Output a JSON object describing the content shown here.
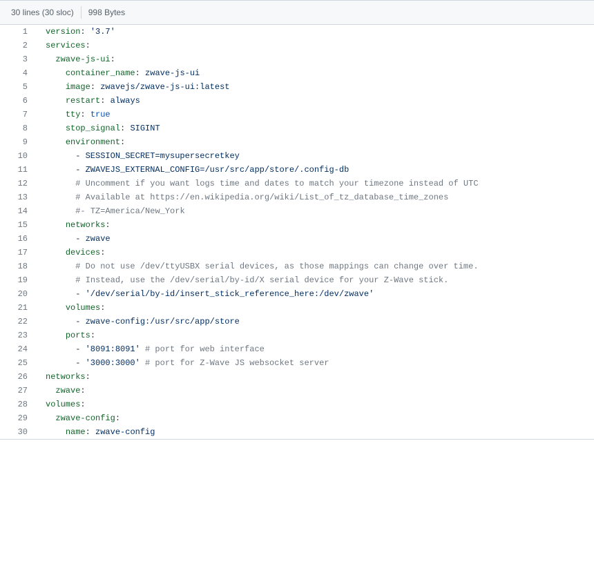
{
  "header": {
    "lines_label": "30 lines (30 sloc)",
    "size_label": "998 Bytes"
  },
  "code": {
    "lines": [
      {
        "n": 1,
        "tokens": [
          {
            "t": "version",
            "c": "pl-ent"
          },
          {
            "t": ": "
          },
          {
            "t": "'3.7'",
            "c": "pl-s"
          }
        ]
      },
      {
        "n": 2,
        "tokens": [
          {
            "t": "services",
            "c": "pl-ent"
          },
          {
            "t": ":"
          }
        ]
      },
      {
        "n": 3,
        "tokens": [
          {
            "t": "  "
          },
          {
            "t": "zwave-js-ui",
            "c": "pl-ent"
          },
          {
            "t": ":"
          }
        ]
      },
      {
        "n": 4,
        "tokens": [
          {
            "t": "    "
          },
          {
            "t": "container_name",
            "c": "pl-ent"
          },
          {
            "t": ": "
          },
          {
            "t": "zwave-js-ui",
            "c": "pl-s"
          }
        ]
      },
      {
        "n": 5,
        "tokens": [
          {
            "t": "    "
          },
          {
            "t": "image",
            "c": "pl-ent"
          },
          {
            "t": ": "
          },
          {
            "t": "zwavejs/zwave-js-ui:latest",
            "c": "pl-s"
          }
        ]
      },
      {
        "n": 6,
        "tokens": [
          {
            "t": "    "
          },
          {
            "t": "restart",
            "c": "pl-ent"
          },
          {
            "t": ": "
          },
          {
            "t": "always",
            "c": "pl-s"
          }
        ]
      },
      {
        "n": 7,
        "tokens": [
          {
            "t": "    "
          },
          {
            "t": "tty",
            "c": "pl-ent"
          },
          {
            "t": ": "
          },
          {
            "t": "true",
            "c": "pl-c1"
          }
        ]
      },
      {
        "n": 8,
        "tokens": [
          {
            "t": "    "
          },
          {
            "t": "stop_signal",
            "c": "pl-ent"
          },
          {
            "t": ": "
          },
          {
            "t": "SIGINT",
            "c": "pl-s"
          }
        ]
      },
      {
        "n": 9,
        "tokens": [
          {
            "t": "    "
          },
          {
            "t": "environment",
            "c": "pl-ent"
          },
          {
            "t": ":"
          }
        ]
      },
      {
        "n": 10,
        "tokens": [
          {
            "t": "      - "
          },
          {
            "t": "SESSION_SECRET=mysupersecretkey",
            "c": "pl-s"
          }
        ]
      },
      {
        "n": 11,
        "tokens": [
          {
            "t": "      - "
          },
          {
            "t": "ZWAVEJS_EXTERNAL_CONFIG=/usr/src/app/store/.config-db",
            "c": "pl-s"
          }
        ]
      },
      {
        "n": 12,
        "tokens": [
          {
            "t": "      "
          },
          {
            "t": "# Uncomment if you want logs time and dates to match your timezone instead of UTC",
            "c": "pl-c"
          }
        ]
      },
      {
        "n": 13,
        "tokens": [
          {
            "t": "      "
          },
          {
            "t": "# Available at https://en.wikipedia.org/wiki/List_of_tz_database_time_zones",
            "c": "pl-c"
          }
        ]
      },
      {
        "n": 14,
        "tokens": [
          {
            "t": "      "
          },
          {
            "t": "#- TZ=America/New_York",
            "c": "pl-c"
          }
        ]
      },
      {
        "n": 15,
        "tokens": [
          {
            "t": "    "
          },
          {
            "t": "networks",
            "c": "pl-ent"
          },
          {
            "t": ":"
          }
        ]
      },
      {
        "n": 16,
        "tokens": [
          {
            "t": "      - "
          },
          {
            "t": "zwave",
            "c": "pl-s"
          }
        ]
      },
      {
        "n": 17,
        "tokens": [
          {
            "t": "    "
          },
          {
            "t": "devices",
            "c": "pl-ent"
          },
          {
            "t": ":"
          }
        ]
      },
      {
        "n": 18,
        "tokens": [
          {
            "t": "      "
          },
          {
            "t": "# Do not use /dev/ttyUSBX serial devices, as those mappings can change over time.",
            "c": "pl-c"
          }
        ]
      },
      {
        "n": 19,
        "tokens": [
          {
            "t": "      "
          },
          {
            "t": "# Instead, use the /dev/serial/by-id/X serial device for your Z-Wave stick.",
            "c": "pl-c"
          }
        ]
      },
      {
        "n": 20,
        "tokens": [
          {
            "t": "      - "
          },
          {
            "t": "'/dev/serial/by-id/insert_stick_reference_here:/dev/zwave'",
            "c": "pl-s"
          }
        ]
      },
      {
        "n": 21,
        "tokens": [
          {
            "t": "    "
          },
          {
            "t": "volumes",
            "c": "pl-ent"
          },
          {
            "t": ":"
          }
        ]
      },
      {
        "n": 22,
        "tokens": [
          {
            "t": "      - "
          },
          {
            "t": "zwave-config:/usr/src/app/store",
            "c": "pl-s"
          }
        ]
      },
      {
        "n": 23,
        "tokens": [
          {
            "t": "    "
          },
          {
            "t": "ports",
            "c": "pl-ent"
          },
          {
            "t": ":"
          }
        ]
      },
      {
        "n": 24,
        "tokens": [
          {
            "t": "      - "
          },
          {
            "t": "'8091:8091'",
            "c": "pl-s"
          },
          {
            "t": " "
          },
          {
            "t": "# port for web interface",
            "c": "pl-c"
          }
        ]
      },
      {
        "n": 25,
        "tokens": [
          {
            "t": "      - "
          },
          {
            "t": "'3000:3000'",
            "c": "pl-s"
          },
          {
            "t": " "
          },
          {
            "t": "# port for Z-Wave JS websocket server",
            "c": "pl-c"
          }
        ]
      },
      {
        "n": 26,
        "tokens": [
          {
            "t": "networks",
            "c": "pl-ent"
          },
          {
            "t": ":"
          }
        ]
      },
      {
        "n": 27,
        "tokens": [
          {
            "t": "  "
          },
          {
            "t": "zwave",
            "c": "pl-ent"
          },
          {
            "t": ":"
          }
        ]
      },
      {
        "n": 28,
        "tokens": [
          {
            "t": "volumes",
            "c": "pl-ent"
          },
          {
            "t": ":"
          }
        ]
      },
      {
        "n": 29,
        "tokens": [
          {
            "t": "  "
          },
          {
            "t": "zwave-config",
            "c": "pl-ent"
          },
          {
            "t": ":"
          }
        ]
      },
      {
        "n": 30,
        "tokens": [
          {
            "t": "    "
          },
          {
            "t": "name",
            "c": "pl-ent"
          },
          {
            "t": ": "
          },
          {
            "t": "zwave-config",
            "c": "pl-s"
          }
        ]
      }
    ]
  }
}
